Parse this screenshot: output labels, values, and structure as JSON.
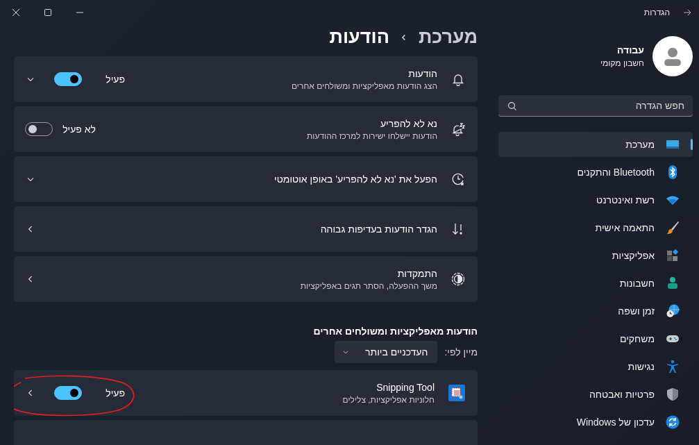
{
  "window": {
    "title": "הגדרות"
  },
  "profile": {
    "name": "עבודה",
    "account_type": "חשבון מקומי"
  },
  "search": {
    "placeholder": "חפש הגדרה"
  },
  "nav_items": [
    {
      "label": "מערכת",
      "selected": true
    },
    {
      "label": "Bluetooth והתקנים",
      "selected": false
    },
    {
      "label": "רשת ואינטרנט",
      "selected": false
    },
    {
      "label": "התאמה אישית",
      "selected": false
    },
    {
      "label": "אפליקציות",
      "selected": false
    },
    {
      "label": "חשבונות",
      "selected": false
    },
    {
      "label": "זמן ושפה",
      "selected": false
    },
    {
      "label": "משחקים",
      "selected": false
    },
    {
      "label": "נגישות",
      "selected": false
    },
    {
      "label": "פרטיות ואבטחה",
      "selected": false
    },
    {
      "label": "עדכון של Windows",
      "selected": false
    }
  ],
  "breadcrumb": {
    "parent": "מערכת",
    "current": "הודעות"
  },
  "settings": [
    {
      "title": "הודעות",
      "description": "הצג הודעות מאפליקציות ומשולחים אחרים",
      "toggle": {
        "on": true,
        "status": "פעיל"
      },
      "kind": "expander"
    },
    {
      "title": "נא לא להפריע",
      "description": "הודעות יישלחו ישירות למרכז ההודעות",
      "toggle": {
        "on": false,
        "status": "לא פעיל"
      },
      "kind": "plain"
    },
    {
      "title": "הפעל את 'נא לא להפריע' באופן אוטומטי",
      "kind": "expander"
    },
    {
      "title": "הגדר הודעות בעדיפות גבוהה",
      "kind": "link"
    },
    {
      "title": "התמקדות",
      "description": "משך ההפעלה, הסתר תגים באפליקציות",
      "kind": "link"
    }
  ],
  "apps_section": {
    "heading": "הודעות מאפליקציות ומשולחים אחרים",
    "sort_label": "מיין לפי:",
    "sort_value": "העדכניים ביותר",
    "apps": [
      {
        "name": "Snipping Tool",
        "description": "חלוניות אפליקציות, צלילים",
        "toggle": {
          "on": true,
          "status": "פעיל"
        },
        "kind": "link"
      }
    ]
  }
}
